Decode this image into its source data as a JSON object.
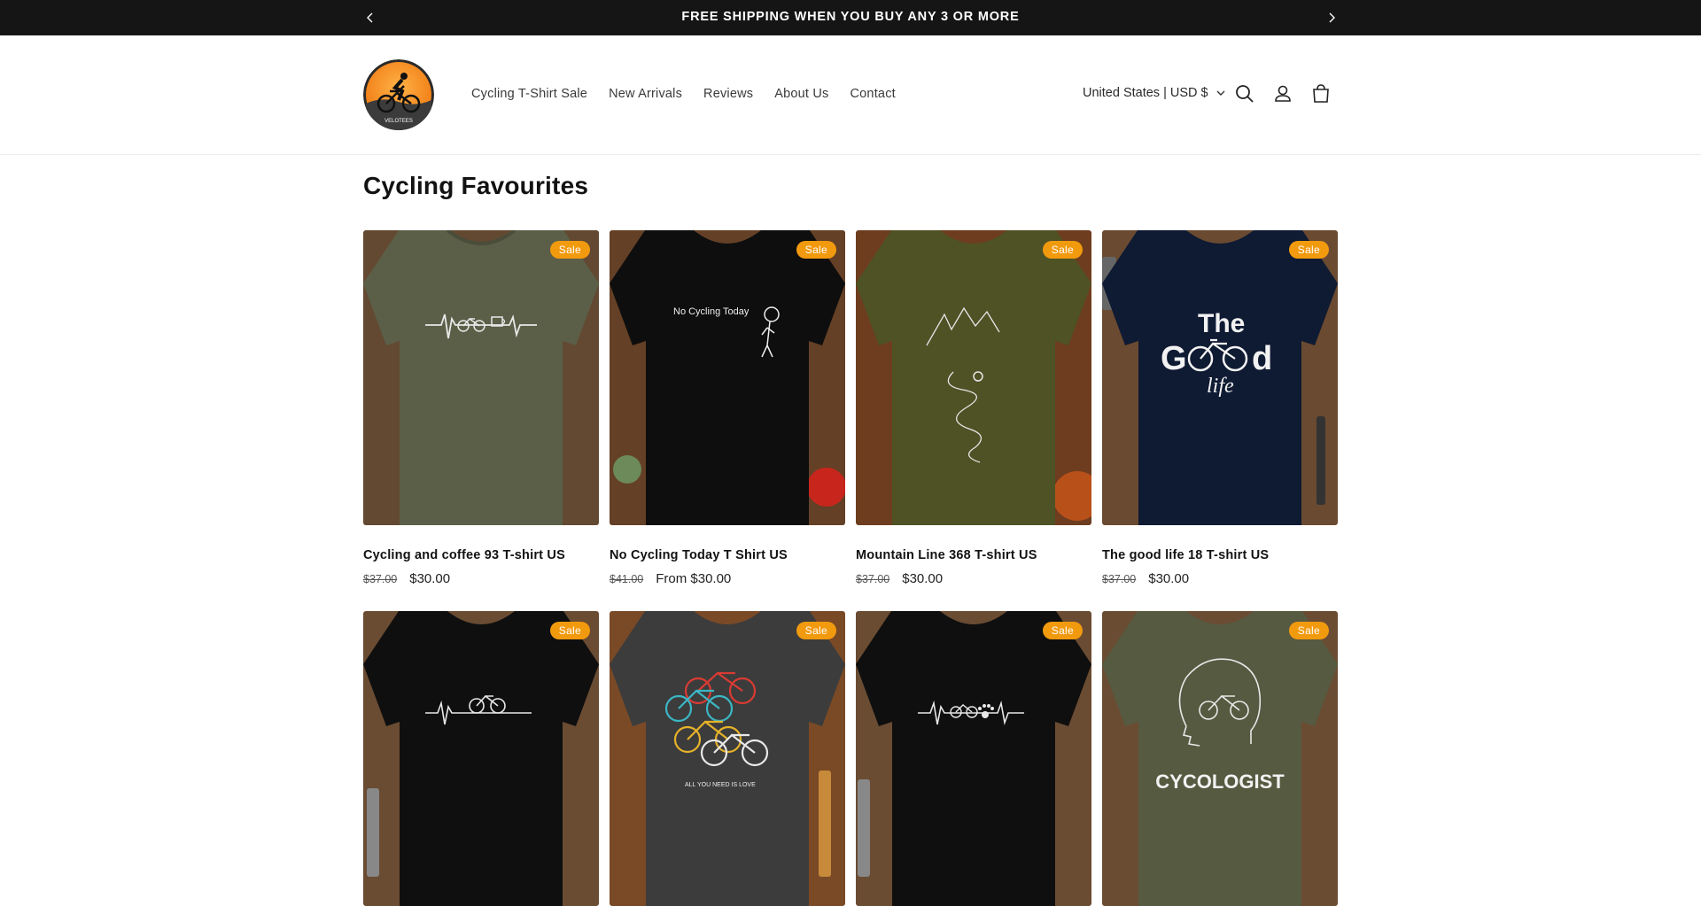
{
  "announcement": {
    "message": "FREE SHIPPING WHEN YOU BUY ANY 3 OR MORE",
    "prev_icon": "chevron-left-icon",
    "next_icon": "chevron-right-icon"
  },
  "header": {
    "logo_text": "VELOTEES",
    "nav": [
      {
        "label": "Cycling T-Shirt Sale"
      },
      {
        "label": "New Arrivals"
      },
      {
        "label": "Reviews"
      },
      {
        "label": "About Us"
      },
      {
        "label": "Contact"
      }
    ],
    "country_selector": "United States | USD $",
    "icons": [
      "search-icon",
      "account-icon",
      "cart-icon"
    ]
  },
  "section": {
    "title": "Cycling Favourites"
  },
  "colors": {
    "sale_badge": "#f29a0e",
    "announcement_bg": "#151515"
  },
  "products": [
    {
      "title": "Cycling and coffee 93 T-shirt US",
      "old_price": "$37.00",
      "price": "$30.00",
      "badge": "Sale",
      "shirt_color": "#5b5f48"
    },
    {
      "title": "No Cycling Today T Shirt US",
      "old_price": "$41.00",
      "price": "From $30.00",
      "badge": "Sale",
      "shirt_color": "#0e0e0e",
      "print_text": "No Cycling Today"
    },
    {
      "title": "Mountain Line 368 T-shirt US",
      "old_price": "$37.00",
      "price": "$30.00",
      "badge": "Sale",
      "shirt_color": "#4e5225"
    },
    {
      "title": "The good life 18 T-shirt US",
      "old_price": "$37.00",
      "price": "$30.00",
      "badge": "Sale",
      "shirt_color": "#0f1a33",
      "print_text_1": "The",
      "print_text_2": "G",
      "print_text_3": "d",
      "print_text_4": "life"
    },
    {
      "badge": "Sale",
      "shirt_color": "#0f0f0f"
    },
    {
      "badge": "Sale",
      "shirt_color": "#3c3c3c",
      "print_text": "ALL YOU NEED IS LOVE"
    },
    {
      "badge": "Sale",
      "shirt_color": "#0f0f0f"
    },
    {
      "badge": "Sale",
      "shirt_color": "#565a40",
      "print_text": "CYCOLOGIST"
    }
  ]
}
